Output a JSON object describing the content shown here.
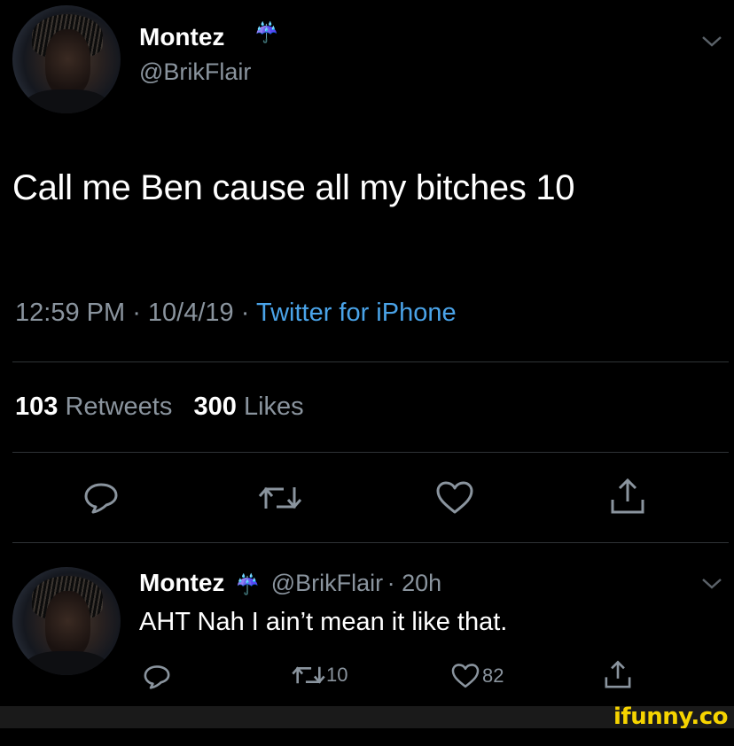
{
  "tweet": {
    "author_name": "Montez",
    "author_emoji": "☔",
    "author_handle": "@BrikFlair",
    "text": "Call me Ben cause all my bitches 10",
    "time": "12:59 PM",
    "date": "10/4/19",
    "client": "Twitter for iPhone",
    "retweets_count": "103",
    "retweets_label": "Retweets",
    "likes_count": "300",
    "likes_label": "Likes"
  },
  "reply": {
    "author_name": "Montez",
    "author_emoji": "☔",
    "author_handle": "@BrikFlair",
    "age": "20h",
    "text": "AHT Nah I ain’t mean it like that.",
    "retweets_count": "10",
    "likes_count": "82"
  },
  "watermark": {
    "text": "ifunny.co",
    "color": "#f6d400"
  },
  "colors": {
    "background": "#000000",
    "secondary_text": "#8a949e",
    "link": "#4aa3e8",
    "divider": "#2f3336"
  },
  "icons": [
    "chevron-down-icon",
    "reply-icon",
    "retweet-icon",
    "like-icon",
    "share-icon",
    "umbrella-emoji"
  ]
}
